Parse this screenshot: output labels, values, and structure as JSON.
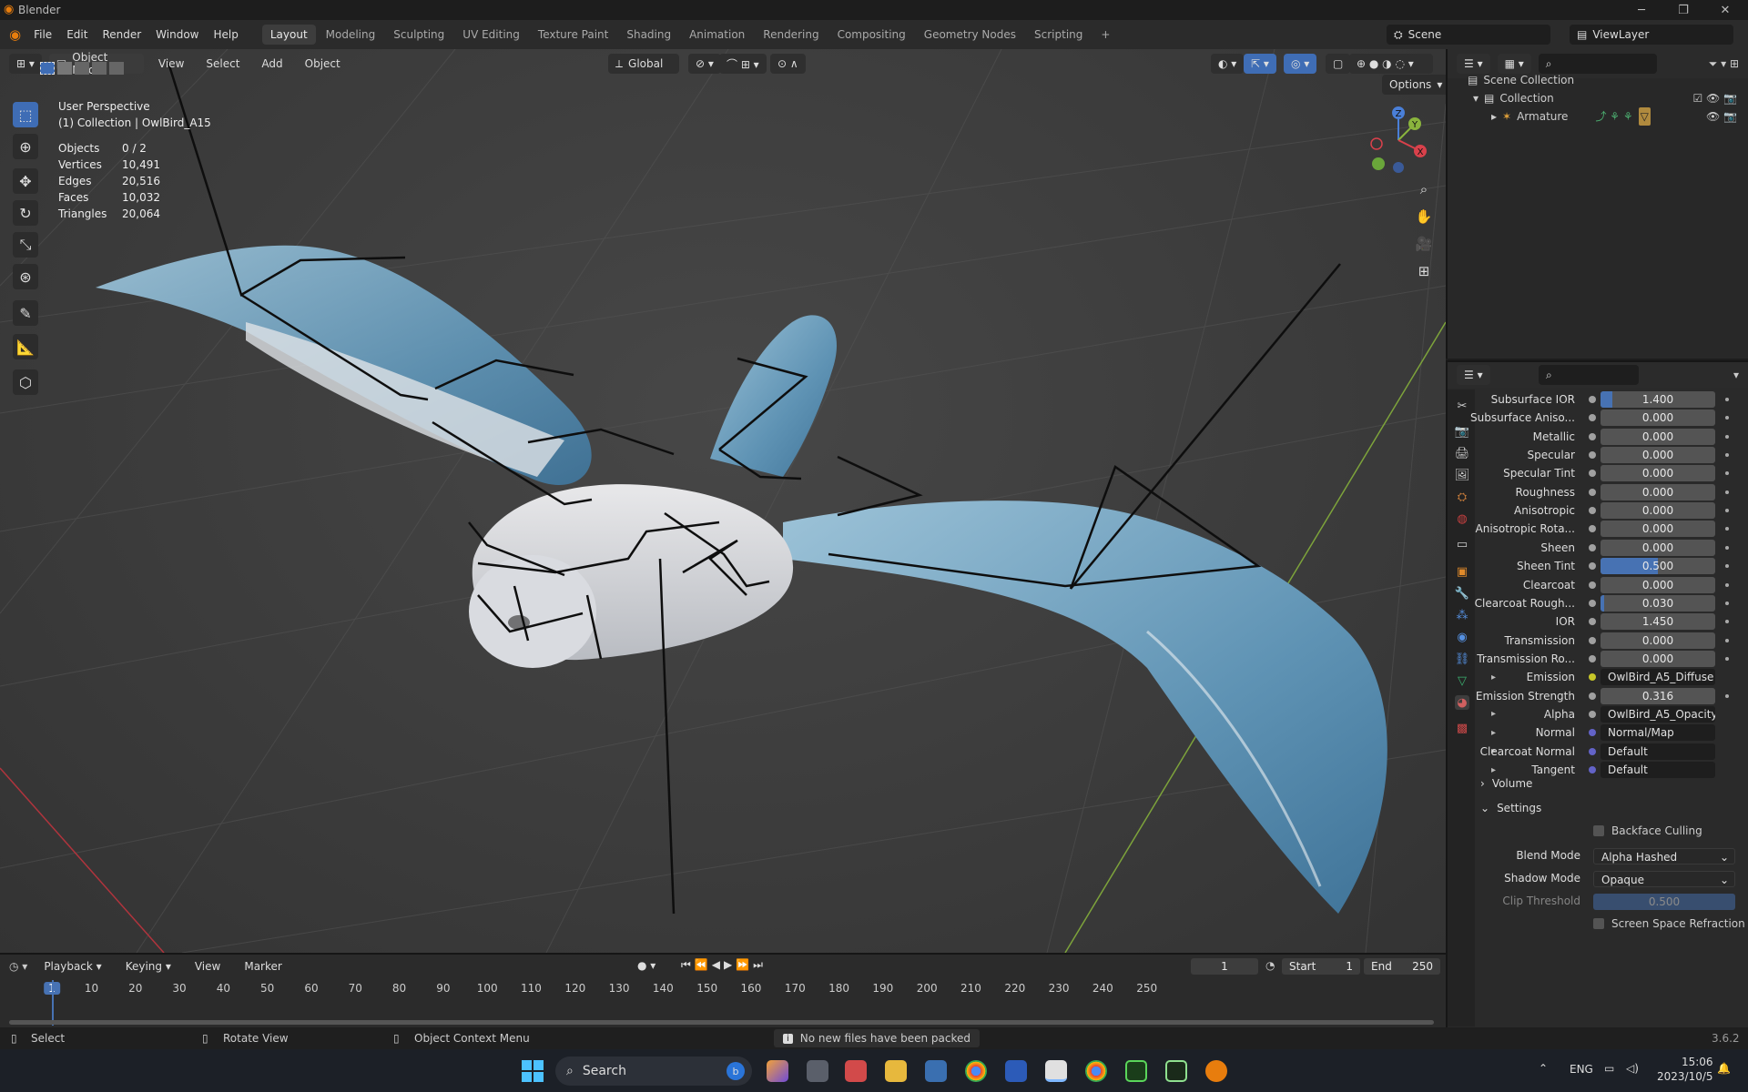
{
  "window": {
    "title": "Blender"
  },
  "menu": {
    "file": "File",
    "edit": "Edit",
    "render": "Render",
    "window": "Window",
    "help": "Help"
  },
  "workspaces": [
    "Layout",
    "Modeling",
    "Sculpting",
    "UV Editing",
    "Texture Paint",
    "Shading",
    "Animation",
    "Rendering",
    "Compositing",
    "Geometry Nodes",
    "Scripting"
  ],
  "scene": {
    "name": "Scene",
    "view_layer": "ViewLayer"
  },
  "viewport_header": {
    "mode": "Object Mode",
    "view": "View",
    "select": "Select",
    "add": "Add",
    "object": "Object",
    "orientation": "Global",
    "options": "Options"
  },
  "viewport": {
    "perspective": "User Perspective",
    "collection_info": "(1) Collection | OwlBird_A15",
    "stats": [
      {
        "label": "Objects",
        "value": "0 / 2"
      },
      {
        "label": "Vertices",
        "value": "10,491"
      },
      {
        "label": "Edges",
        "value": "20,516"
      },
      {
        "label": "Faces",
        "value": "10,032"
      },
      {
        "label": "Triangles",
        "value": "20,064"
      }
    ],
    "gizmo": {
      "z": "Z",
      "y": "Y",
      "x": "X"
    }
  },
  "outliner": {
    "scene_collection": "Scene Collection",
    "collection": "Collection",
    "armature": "Armature"
  },
  "properties": {
    "rows": [
      {
        "label": "Subsurface IOR",
        "value": "1.400",
        "fill": 0.1,
        "kind": "num"
      },
      {
        "label": "Subsurface Aniso...",
        "value": "0.000",
        "fill": 0,
        "kind": "num"
      },
      {
        "label": "Metallic",
        "value": "0.000",
        "fill": 0,
        "kind": "num"
      },
      {
        "label": "Specular",
        "value": "0.000",
        "fill": 0,
        "kind": "num"
      },
      {
        "label": "Specular Tint",
        "value": "0.000",
        "fill": 0,
        "kind": "num"
      },
      {
        "label": "Roughness",
        "value": "0.000",
        "fill": 0,
        "kind": "num"
      },
      {
        "label": "Anisotropic",
        "value": "0.000",
        "fill": 0,
        "kind": "num"
      },
      {
        "label": "Anisotropic Rota...",
        "value": "0.000",
        "fill": 0,
        "kind": "num"
      },
      {
        "label": "Sheen",
        "value": "0.000",
        "fill": 0,
        "kind": "num"
      },
      {
        "label": "Sheen Tint",
        "value": "0.500",
        "fill": 0.5,
        "kind": "num"
      },
      {
        "label": "Clearcoat",
        "value": "0.000",
        "fill": 0,
        "kind": "num"
      },
      {
        "label": "Clearcoat Rough...",
        "value": "0.030",
        "fill": 0.03,
        "kind": "num"
      },
      {
        "label": "IOR",
        "value": "1.450",
        "fill": 0,
        "kind": "num"
      },
      {
        "label": "Transmission",
        "value": "0.000",
        "fill": 0,
        "kind": "num"
      },
      {
        "label": "Transmission Ro...",
        "value": "0.000",
        "fill": 0,
        "kind": "num"
      },
      {
        "label": "Emission",
        "value": "OwlBird_A5_Diffuse",
        "kind": "link",
        "socket": "#c7c729"
      },
      {
        "label": "Emission Strength",
        "value": "0.316",
        "fill": 0,
        "kind": "num"
      },
      {
        "label": "Alpha",
        "value": "OwlBird_A5_Opacity",
        "kind": "link",
        "socket": "#a0a0a0"
      },
      {
        "label": "Normal",
        "value": "Normal/Map",
        "kind": "link",
        "socket": "#6363c7"
      },
      {
        "label": "Clearcoat Normal",
        "value": "Default",
        "kind": "link",
        "socket": "#6363c7"
      },
      {
        "label": "Tangent",
        "value": "Default",
        "kind": "link",
        "socket": "#6363c7"
      }
    ],
    "volume": "Volume",
    "settings": "Settings",
    "backface_culling": "Backface Culling",
    "blend_mode_label": "Blend Mode",
    "blend_mode": "Alpha Hashed",
    "shadow_mode_label": "Shadow Mode",
    "shadow_mode": "Opaque",
    "clip_threshold_label": "Clip Threshold",
    "clip_threshold": "0.500",
    "screen_space_refraction": "Screen Space Refraction"
  },
  "timeline": {
    "playback": "Playback",
    "keying": "Keying",
    "view": "View",
    "marker": "Marker",
    "current_frame": "1",
    "start_label": "Start",
    "start": "1",
    "end_label": "End",
    "end": "250",
    "ticks": [
      "1",
      "10",
      "20",
      "30",
      "40",
      "50",
      "60",
      "70",
      "80",
      "90",
      "100",
      "110",
      "120",
      "130",
      "140",
      "150",
      "160",
      "170",
      "180",
      "190",
      "200",
      "210",
      "220",
      "230",
      "240",
      "250"
    ]
  },
  "statusbar": {
    "select": "Select",
    "rotate": "Rotate View",
    "context": "Object Context Menu",
    "message": "No new files have been packed",
    "version": "3.6.2"
  },
  "taskbar": {
    "search": "Search",
    "lang": "ENG",
    "time": "15:06",
    "date": "2023/10/5"
  }
}
